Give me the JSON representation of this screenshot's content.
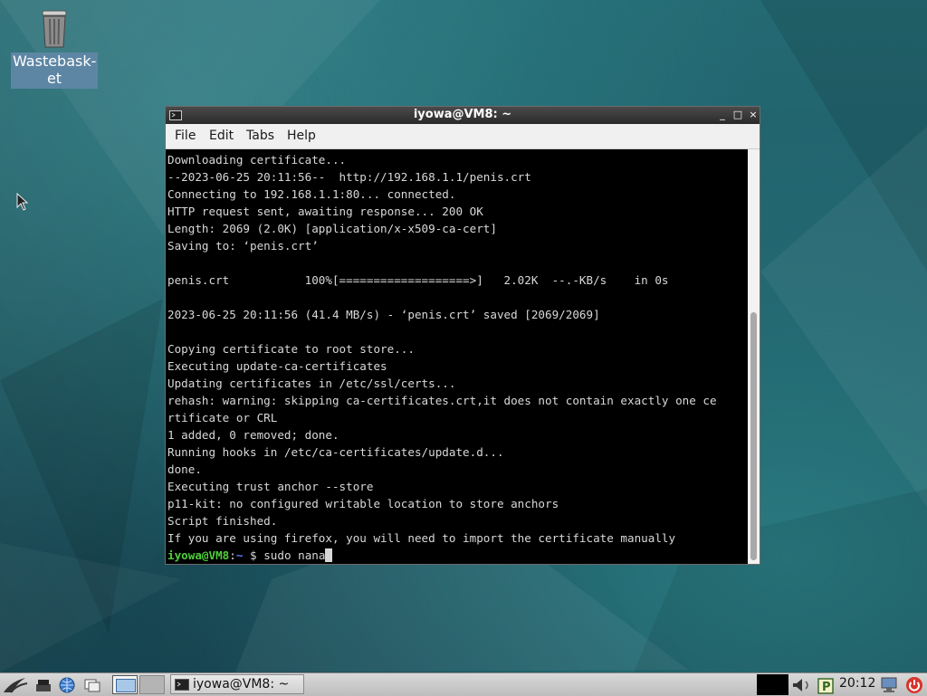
{
  "desktop": {
    "icons": [
      {
        "label": "Wastebask-et",
        "icon": "trash-icon"
      }
    ]
  },
  "terminal": {
    "title": "iyowa@VM8: ~",
    "menu": [
      "File",
      "Edit",
      "Tabs",
      "Help"
    ],
    "lines": [
      "Downloading certificate...",
      "--2023-06-25 20:11:56--  http://192.168.1.1/penis.crt",
      "Connecting to 192.168.1.1:80... connected.",
      "HTTP request sent, awaiting response... 200 OK",
      "Length: 2069 (2.0K) [application/x-x509-ca-cert]",
      "Saving to: ‘penis.crt’",
      "",
      "penis.crt           100%[===================>]   2.02K  --.-KB/s    in 0s",
      "",
      "2023-06-25 20:11:56 (41.4 MB/s) - ‘penis.crt’ saved [2069/2069]",
      "",
      "Copying certificate to root store...",
      "Executing update-ca-certificates",
      "Updating certificates in /etc/ssl/certs...",
      "rehash: warning: skipping ca-certificates.crt,it does not contain exactly one ce",
      "rtificate or CRL",
      "1 added, 0 removed; done.",
      "Running hooks in /etc/ca-certificates/update.d...",
      "done.",
      "Executing trust anchor --store",
      "p11-kit: no configured writable location to store anchors",
      "Script finished.",
      "If you are using firefox, you will need to import the certificate manually"
    ],
    "prompt": {
      "user": "iyowa@VM8",
      "sep": ":",
      "path": "~",
      "symbol": "$",
      "command": "sudo nana"
    },
    "controls": {
      "minimize": "_",
      "maximize": "□",
      "close": "×"
    }
  },
  "taskbar": {
    "launchers": [
      "start-menu-icon",
      "show-desktop-icon",
      "browser-icon",
      "file-manager-icon",
      "workspace-1",
      "workspace-2"
    ],
    "tasks": [
      {
        "label": "iyowa@VM8: ~",
        "icon": "terminal-icon"
      }
    ],
    "clock": "20:12",
    "tray": [
      "audio-icon",
      "clipboard-icon",
      "network-icon",
      "power-icon"
    ]
  },
  "colors": {
    "prompt_user": "#4fcf3c",
    "prompt_path": "#5b7fff",
    "terminal_bg": "#000000",
    "terminal_fg": "#d8d8d8"
  }
}
